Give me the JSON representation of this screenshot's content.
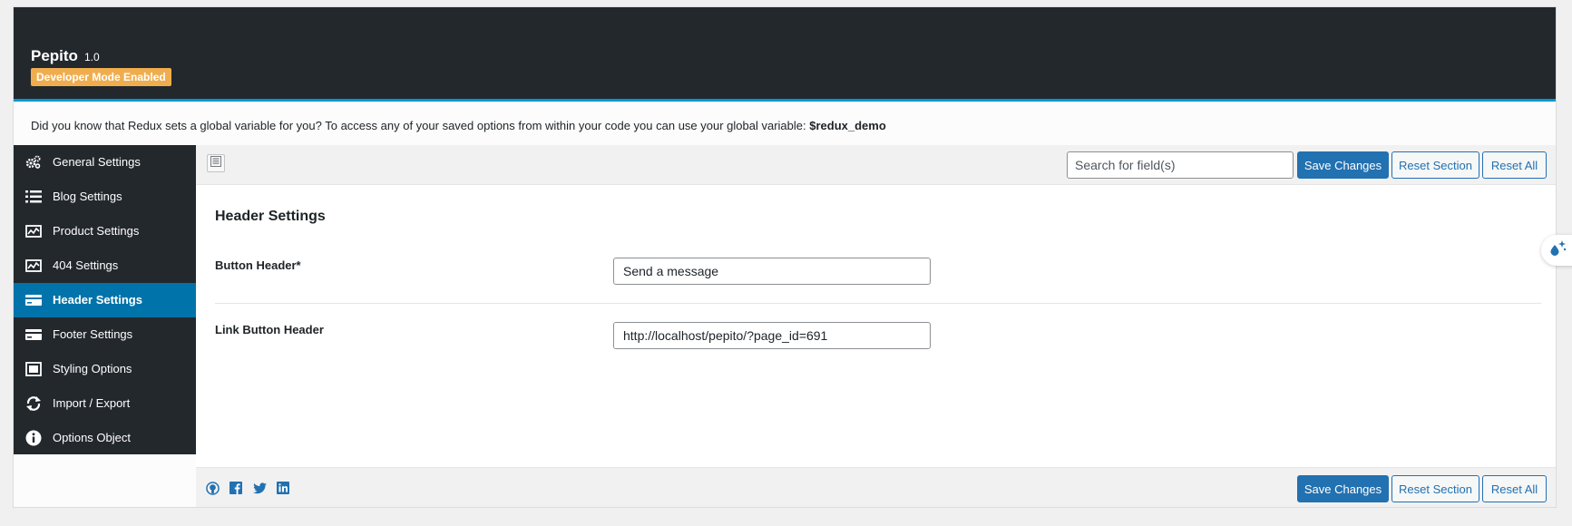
{
  "app": {
    "title": "Pepito",
    "version": "1.0",
    "badge": "Developer Mode Enabled"
  },
  "notice": {
    "text": "Did you know that Redux sets a global variable for you? To access any of your saved options from within your code you can use your global variable: ",
    "variable": "$redux_demo"
  },
  "sidebar": {
    "items": [
      {
        "label": "General Settings",
        "icon": "gears-icon"
      },
      {
        "label": "Blog Settings",
        "icon": "list-icon"
      },
      {
        "label": "Product Settings",
        "icon": "chart-icon"
      },
      {
        "label": "404 Settings",
        "icon": "chart-icon"
      },
      {
        "label": "Header Settings",
        "icon": "card-icon",
        "active": true
      },
      {
        "label": "Footer Settings",
        "icon": "card-icon"
      },
      {
        "label": "Styling Options",
        "icon": "screen-icon"
      },
      {
        "label": "Import / Export",
        "icon": "refresh-icon"
      },
      {
        "label": "Options Object",
        "icon": "info-icon"
      }
    ]
  },
  "toolbar": {
    "search_placeholder": "Search for field(s)",
    "save_label": "Save Changes",
    "reset_section_label": "Reset Section",
    "reset_all_label": "Reset All"
  },
  "section": {
    "title": "Header Settings",
    "fields": [
      {
        "label": "Button Header*",
        "value": "Send a message"
      },
      {
        "label": "Link Button Header",
        "value": "http://localhost/pepito/?page_id=691"
      }
    ]
  },
  "footer": {
    "save_label": "Save Changes",
    "reset_section_label": "Reset Section",
    "reset_all_label": "Reset All",
    "social_icons": [
      "github-icon",
      "facebook-icon",
      "twitter-icon",
      "linkedin-icon"
    ]
  },
  "colors": {
    "header_bg": "#23282d",
    "accent": "#0073aa",
    "badge": "#f0ad4e",
    "primary_button": "#2271b1"
  }
}
